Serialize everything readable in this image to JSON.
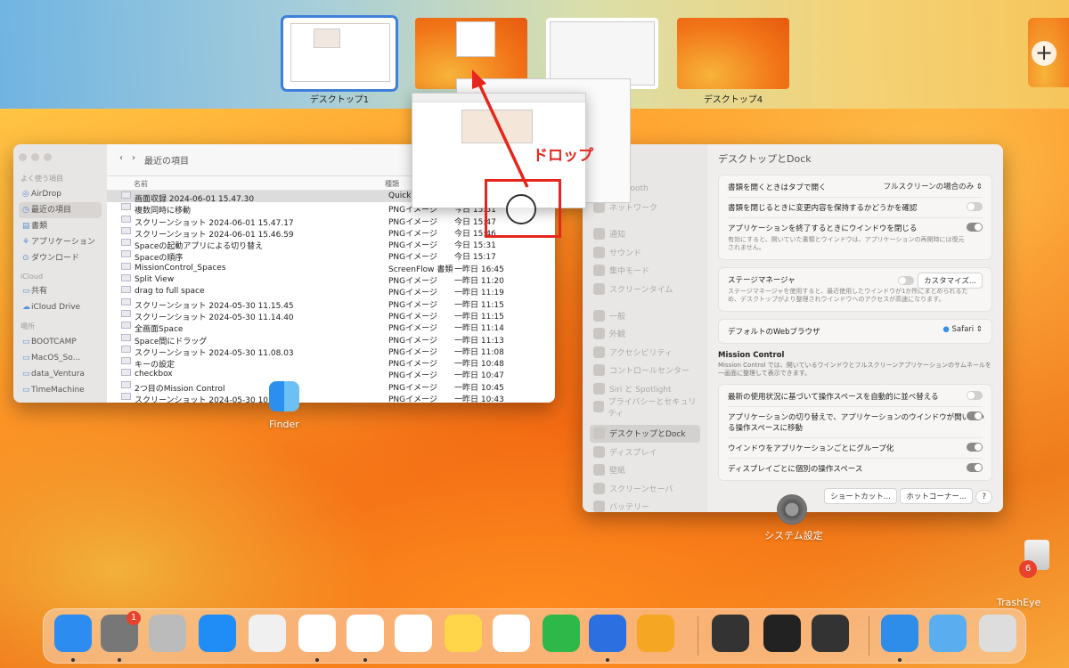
{
  "spaces": [
    {
      "label": "デスクトップ1",
      "selected": true
    },
    {
      "label": "",
      "selected": false
    },
    {
      "label": "",
      "selected": false
    },
    {
      "label": "デスクトップ4",
      "selected": false
    }
  ],
  "add_space_symbol": "+",
  "annotation": {
    "text": "ドロップ",
    "color": "#e5261d"
  },
  "finder": {
    "title": "最近の項目",
    "sidebar_sections": {
      "favorites": "よく使う項目",
      "icloud": "iCloud",
      "locations": "場所"
    },
    "favorites": [
      "AirDrop",
      "最近の項目",
      "書類",
      "アプリケーション",
      "ダウンロード"
    ],
    "icloud_items": [
      "共有",
      "iCloud Drive"
    ],
    "locations": [
      "BOOTCAMP",
      "MacOS_So...",
      "data_Ventura",
      "TimeMachine"
    ],
    "columns": {
      "name": "名前",
      "kind": "種類"
    },
    "rows": [
      {
        "name": "画面収録 2024-06-01 15.47.30",
        "kind": "QuickT",
        "date": ""
      },
      {
        "name": "複数同時に移動",
        "kind": "PNGイメージ",
        "date": "今日 15:51"
      },
      {
        "name": "スクリーンショット 2024-06-01 15.47.17",
        "kind": "PNGイメージ",
        "date": "今日 15:47"
      },
      {
        "name": "スクリーンショット 2024-06-01 15.46.59",
        "kind": "PNGイメージ",
        "date": "今日 15:46"
      },
      {
        "name": "Spaceの起動アプリによる切り替え",
        "kind": "PNGイメージ",
        "date": "今日 15:31"
      },
      {
        "name": "Spaceの順序",
        "kind": "PNGイメージ",
        "date": "今日 15:17"
      },
      {
        "name": "MissionControl_Spaces",
        "kind": "ScreenFlow 書類",
        "date": "一昨日 16:45"
      },
      {
        "name": "Split View",
        "kind": "PNGイメージ",
        "date": "一昨日 11:20"
      },
      {
        "name": "drag to full space",
        "kind": "PNGイメージ",
        "date": "一昨日 11:19"
      },
      {
        "name": "スクリーンショット 2024-05-30 11.15.45",
        "kind": "PNGイメージ",
        "date": "一昨日 11:15"
      },
      {
        "name": "スクリーンショット 2024-05-30 11.14.40",
        "kind": "PNGイメージ",
        "date": "一昨日 11:15"
      },
      {
        "name": "全画面Space",
        "kind": "PNGイメージ",
        "date": "一昨日 11:14"
      },
      {
        "name": "Space間にドラッグ",
        "kind": "PNGイメージ",
        "date": "一昨日 11:13"
      },
      {
        "name": "スクリーンショット 2024-05-30 11.08.03",
        "kind": "PNGイメージ",
        "date": "一昨日 11:08"
      },
      {
        "name": "キーの設定",
        "kind": "PNGイメージ",
        "date": "一昨日 10:48"
      },
      {
        "name": "checkbox",
        "kind": "PNGイメージ",
        "date": "一昨日 10:47"
      },
      {
        "name": "2つ目のMission Control",
        "kind": "PNGイメージ",
        "date": "一昨日 10:45"
      },
      {
        "name": "スクリーンショット 2024-05-30 10.42",
        "kind": "PNGイメージ",
        "date": "一昨日 10:43"
      }
    ],
    "app_label": "Finder"
  },
  "settings": {
    "title": "デスクトップとDock",
    "sidebar": [
      "Bluetooth",
      "ネットワーク",
      "通知",
      "サウンド",
      "集中モード",
      "スクリーンタイム",
      "一般",
      "外観",
      "アクセシビリティ",
      "コントロールセンター",
      "Siri と Spotlight",
      "プライバシーとセキュリティ",
      "デスクトップとDock",
      "ディスプレイ",
      "壁紙",
      "スクリーンセーバ",
      "バッテリー"
    ],
    "rows": {
      "open_docs": "書類を開くときはタブで開く",
      "open_docs_value": "フルスクリーンの場合のみ",
      "confirm_changes": "書類を閉じるときに変更内容を保持するかどうかを確認",
      "close_windows": "アプリケーションを終了するときにウインドウを閉じる",
      "close_windows_desc": "有効にすると、開いていた書類とウインドウは、アプリケーションの再開時には復元されません。",
      "stage_manager": "ステージマネージャ",
      "stage_manager_desc": "ステージマネージャを使用すると、最近使用したウインドウが1か所にまとめられるため、デスクトップがより整理されウインドウへのアクセスが高速になります。",
      "customize": "カスタマイズ...",
      "default_browser": "デフォルトのWebブラウザ",
      "browser_value": "Safari",
      "mc_title": "Mission Control",
      "mc_desc": "Mission Control では、開いているウインドウとフルスクリーンアプリケーションのサムネールを一画面に整理して表示できます。",
      "auto_rearrange": "最新の使用状況に基づいて操作スペースを自動的に並べ替える",
      "switch_app": "アプリケーションの切り替えで、アプリケーションのウインドウが開いている操作スペースに移動",
      "group_windows": "ウインドウをアプリケーションごとにグループ化",
      "separate_spaces": "ディスプレイごとに個別の操作スペース",
      "shortcuts": "ショートカット...",
      "hot_corners": "ホットコーナー...",
      "help": "?"
    },
    "app_label": "システム設定"
  },
  "trash": {
    "label": "TrashEye",
    "badge": "6"
  },
  "dock": {
    "settings_badge": "1",
    "apps": [
      "finder-icon",
      "system-settings-icon",
      "migration-icon",
      "app-store-icon",
      "launchpad-icon",
      "safari-icon",
      "chrome-icon",
      "photos-icon",
      "notes-icon",
      "textedit-icon",
      "numbers-icon",
      "keynote-icon",
      "pages-icon",
      "bbedit-icon",
      "screenflow-icon",
      "quicktime-icon",
      "documents-folder-icon",
      "downloads-folder-icon",
      "trash-icon"
    ]
  }
}
